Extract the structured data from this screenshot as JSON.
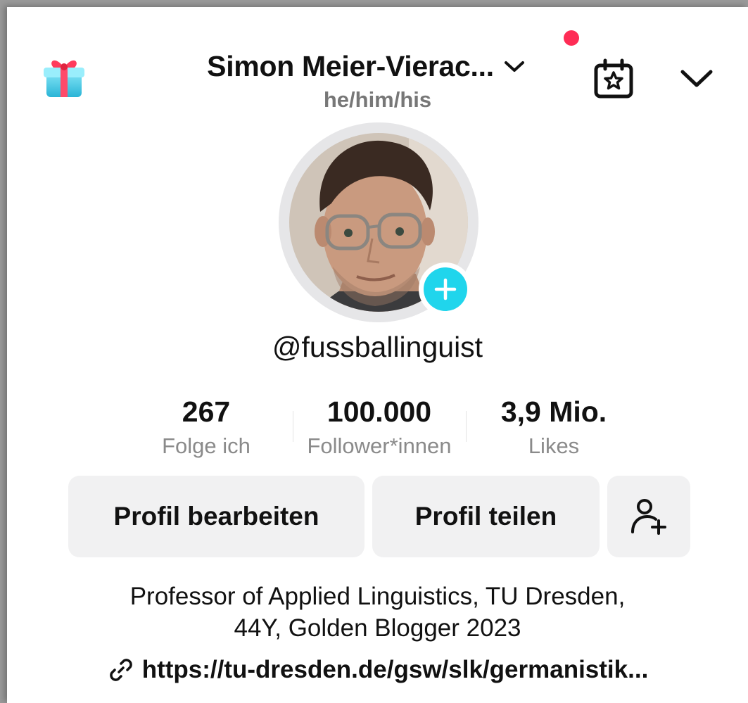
{
  "header": {
    "title": "Simon Meier-Vierac...",
    "pronouns": "he/him/his",
    "icons": [
      "gift-icon",
      "chevron-down-icon",
      "calendar-star-icon",
      "chevron-down-icon"
    ],
    "notification_color": "#fe2c55"
  },
  "profile": {
    "handle": "@fussballinguist",
    "avatar_badge_color": "#20d5ec"
  },
  "stats": [
    {
      "value": "267",
      "label": "Folge ich"
    },
    {
      "value": "100.000",
      "label": "Follower*innen"
    },
    {
      "value": "3,9 Mio.",
      "label": "Likes"
    }
  ],
  "actions": {
    "edit_label": "Profil bearbeiten",
    "share_label": "Profil teilen"
  },
  "bio": {
    "line1": "Professor of Applied Linguistics, TU Dresden,",
    "line2": "44Y, Golden Blogger 2023"
  },
  "link": {
    "text": "https://tu-dresden.de/gsw/slk/germanistik..."
  }
}
